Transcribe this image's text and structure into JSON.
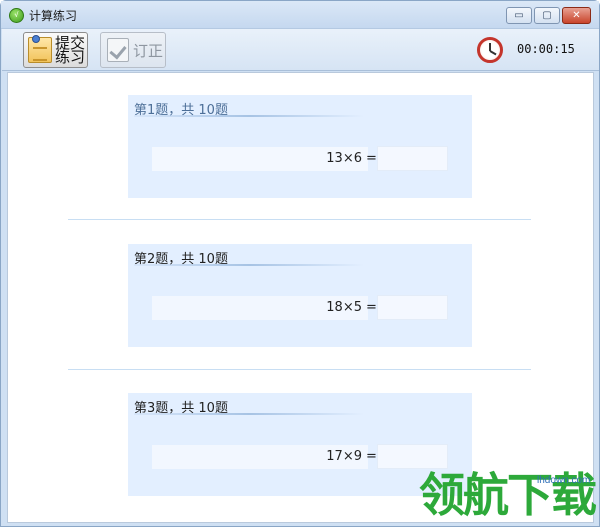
{
  "window": {
    "title": "计算练习",
    "app_icon": "app-icon",
    "controls": {
      "minimize": "▭",
      "maximize": "▢",
      "close": "✕"
    }
  },
  "toolbar": {
    "submit_label": "提交练习",
    "submit_icon": "notepad-icon",
    "correct_label": "订正",
    "correct_icon": "checkmark-icon",
    "timer_icon": "clock-icon",
    "timer": "00:00:15"
  },
  "questions": [
    {
      "title": "第1题，共 10题",
      "expression": "13×6",
      "equals": "=",
      "answer": ""
    },
    {
      "title": "第2题，共 10题",
      "expression": "18×5",
      "equals": "=",
      "answer": ""
    },
    {
      "title": "第3题，共 10题",
      "expression": "17×9",
      "equals": "=",
      "answer": ""
    }
  ],
  "watermark": {
    "text": "领航下载",
    "url": "lhdown.com"
  },
  "colors": {
    "accent": "#4d6f98",
    "card_bg": "#e3efff",
    "watermark_green": "#2da93a",
    "clock_red": "#c4352c"
  }
}
